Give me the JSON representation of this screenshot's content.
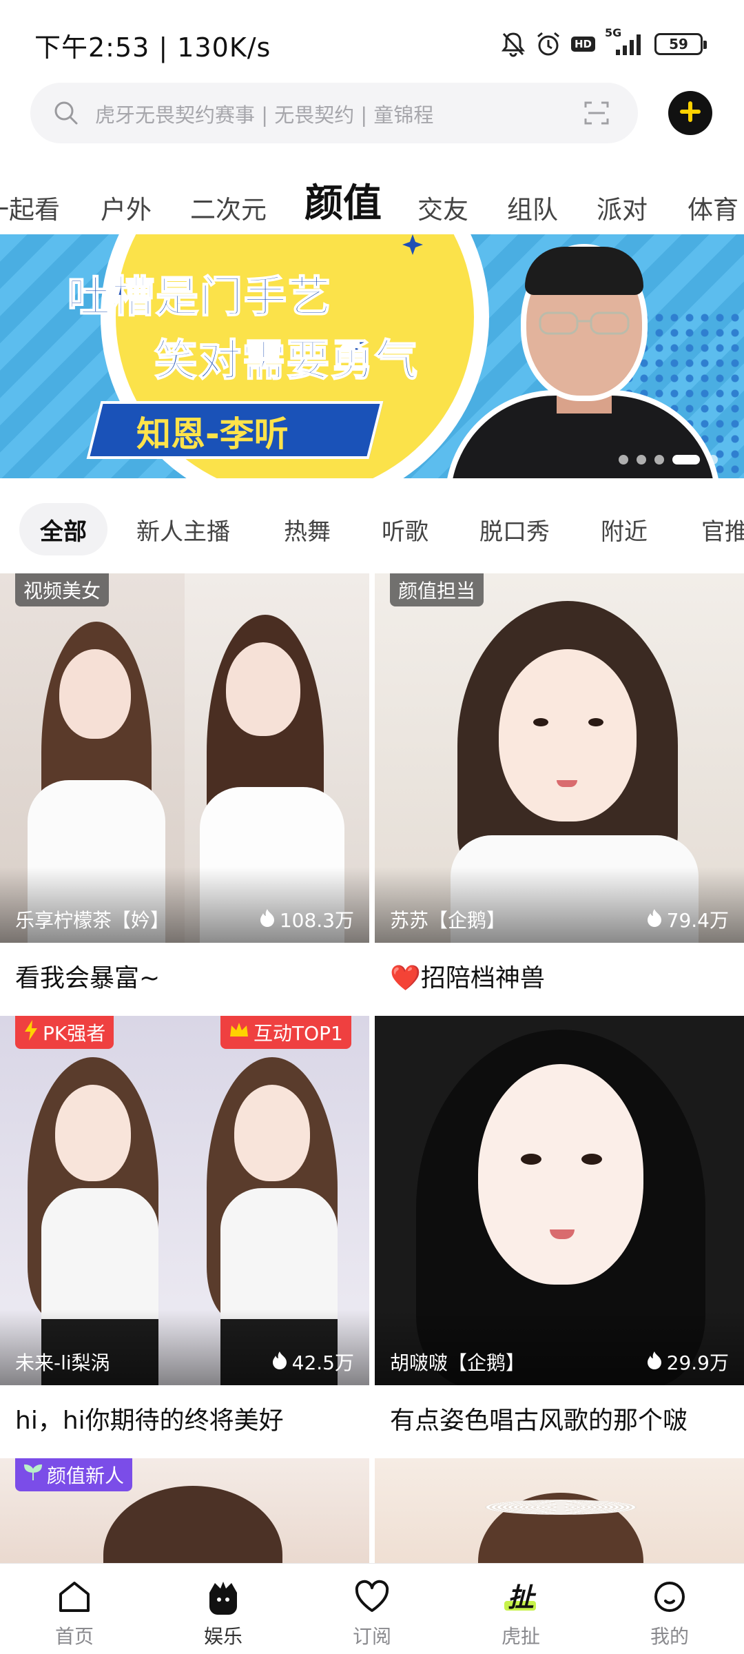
{
  "status_bar": {
    "time": "下午2:53 | 130K/s",
    "signal": "5G",
    "hd": "HD",
    "battery": "59",
    "icons": [
      "mute-bell-icon",
      "alarm-icon",
      "hd-icon",
      "signal-5g-icon",
      "battery-icon"
    ]
  },
  "search": {
    "placeholder": "虎牙无畏契约赛事 | 无畏契约 | 童锦程"
  },
  "category_tabs": [
    "一起看",
    "户外",
    "二次元",
    "颜值",
    "交友",
    "组队",
    "派对",
    "体育"
  ],
  "category_active": "颜值",
  "banner": {
    "line1": "吐槽是门手艺",
    "line2": "笑对需要勇气",
    "name": "知恩-李听",
    "pages": 5,
    "active_page": 4
  },
  "sub_tabs": [
    "全部",
    "新人主播",
    "热舞",
    "听歌",
    "脱口秀",
    "附近",
    "官推"
  ],
  "sub_active": "全部",
  "cards": [
    {
      "tag": "视频美女",
      "tag2": "",
      "streamer": "乐享柠檬茶【妗】",
      "heat": "108.3万",
      "title": "看我会暴富~"
    },
    {
      "tag": "颜值担当",
      "tag2": "",
      "streamer": "苏苏【企鹅】",
      "heat": "79.4万",
      "title": "❤️招陪档神兽"
    },
    {
      "tag": "PK强者",
      "tag2": "互动TOP1",
      "streamer": "未来-li梨涡",
      "heat": "42.5万",
      "title": "hi，hi你期待的终将美好"
    },
    {
      "tag": "",
      "tag2": "",
      "streamer": "胡啵啵【企鹅】",
      "heat": "29.9万",
      "title": "有点姿色唱古风歌的那个啵"
    },
    {
      "tag": "颜值新人",
      "tag2": "",
      "streamer": "",
      "heat": "",
      "title": ""
    },
    {
      "tag": "",
      "tag2": "",
      "streamer": "",
      "heat": "",
      "title": ""
    }
  ],
  "bottom_nav": [
    {
      "label": "首页",
      "icon": "home-icon"
    },
    {
      "label": "娱乐",
      "icon": "entertainment-icon"
    },
    {
      "label": "订阅",
      "icon": "heart-icon"
    },
    {
      "label": "虎扯",
      "icon": "huche-icon"
    },
    {
      "label": "我的",
      "icon": "profile-icon"
    }
  ],
  "bottom_nav_active": "娱乐",
  "colors": {
    "accent_yellow": "#ffd200",
    "tag_red": "#ef4040",
    "tag_purple": "#7b4de8",
    "banner_blue": "#54b6e8"
  }
}
